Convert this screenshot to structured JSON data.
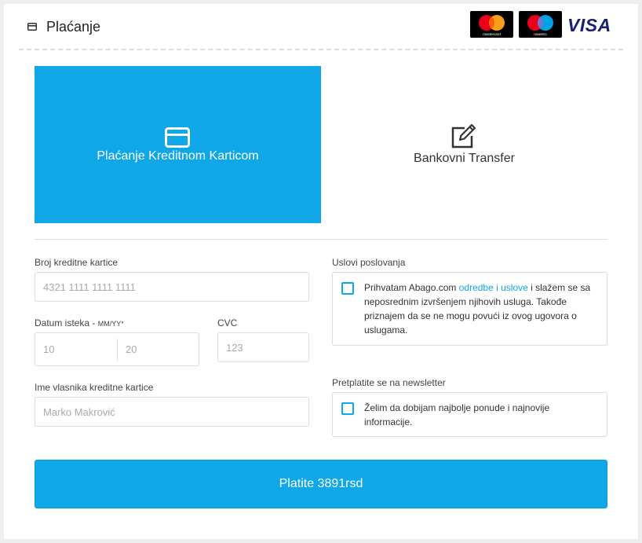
{
  "header": {
    "title": "Plaćanje",
    "icon": "credit-card-icon",
    "logos": {
      "mastercard": "mastercard",
      "maestro": "maestro",
      "visa": "VISA"
    }
  },
  "colors": {
    "accent": "#0fa7e8",
    "visa": "#1a1f71",
    "mastercard_red": "#eb001b",
    "mastercard_yellow": "#f79e1b",
    "maestro_blue": "#00a2e5"
  },
  "payment_methods": [
    {
      "label": "Plaćanje Kreditnom Karticom",
      "icon": "credit-card-icon",
      "selected": true
    },
    {
      "label": "Bankovni Transfer",
      "icon": "edit-icon",
      "selected": false
    }
  ],
  "form": {
    "card_number": {
      "label": "Broj kreditne kartice",
      "placeholder": "4321 1111 1111 1111",
      "value": ""
    },
    "expiry": {
      "label": "Datum isteka - ",
      "label_hint": "MM/YY*",
      "month_placeholder": "10",
      "year_placeholder": "20"
    },
    "cvc": {
      "label": "CVC",
      "placeholder": "123"
    },
    "holder": {
      "label": "Ime vlasnika kreditne kartice",
      "placeholder": "Marko Makrović"
    }
  },
  "terms": {
    "label": "Uslovi poslovanja",
    "text_before": "Prihvatam Abago.com ",
    "link": "odredbe i uslove",
    "text_after": " i slažem se sa neposrednim izvršenjem njihovih usluga. Takođe priznajem da se ne mogu povući iz ovog ugovora o uslugama.",
    "checked": false
  },
  "newsletter": {
    "label": "Pretplatite se na newsletter",
    "text": "Želim da dobijam najbolje ponude i najnovije informacije.",
    "checked": false
  },
  "pay_button": {
    "label": "Platite 3891rsd"
  }
}
